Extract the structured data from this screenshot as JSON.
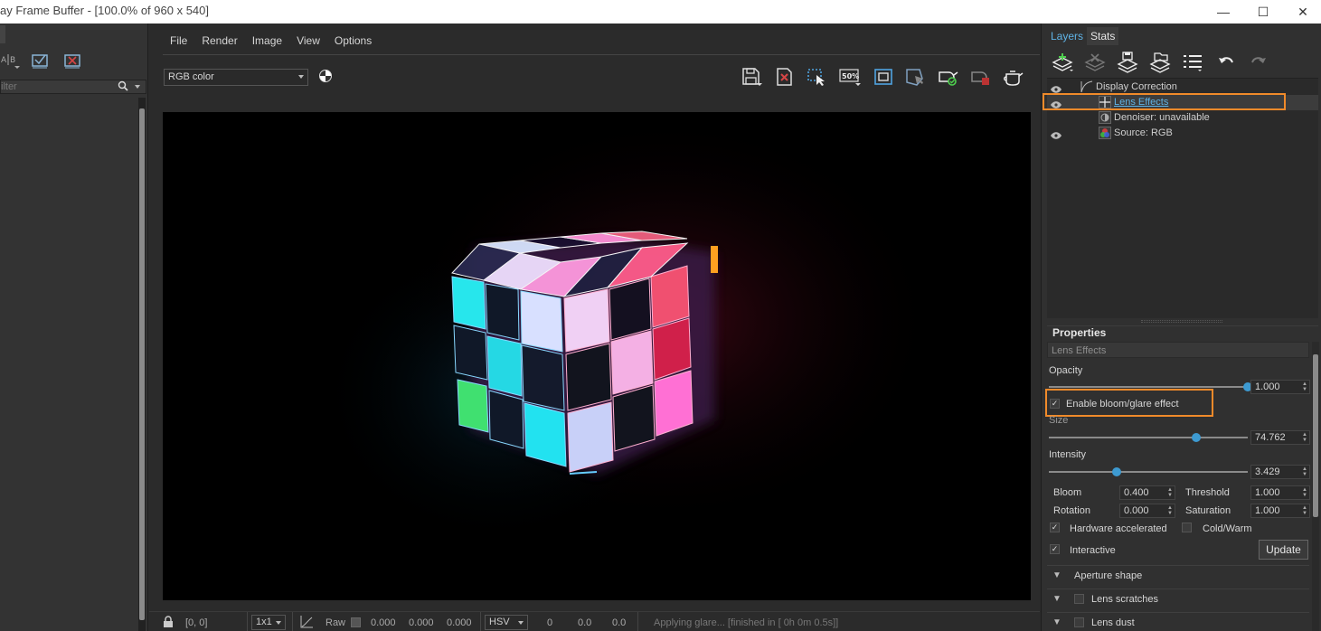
{
  "window": {
    "title": "ay Frame Buffer - [100.0% of 960 x 540]",
    "minimize_glyph": "—",
    "maximize_glyph": "☐",
    "close_glyph": "✕"
  },
  "left_panel": {
    "filter_placeholder": "ilter",
    "icons": [
      "ab-compare-icon",
      "check-all-icon",
      "clear-all-icon"
    ]
  },
  "menu": {
    "items": [
      "File",
      "Render",
      "Image",
      "View",
      "Options"
    ]
  },
  "toolbar": {
    "channel": "RGB color",
    "zoom_badge": "50%",
    "icons": [
      "save-icon",
      "clear-icon",
      "region-render-icon",
      "zoom-50-icon",
      "frame-icon",
      "track-mouse-icon",
      "render-icon",
      "stop-render-icon",
      "teapot-render-icon"
    ]
  },
  "statusbar": {
    "coords": "[0, 0]",
    "zoom": "1x1",
    "raw_label": "Raw",
    "r": "0.000",
    "g": "0.000",
    "b": "0.000",
    "color_mode": "HSV",
    "h": "0",
    "s": "0.0",
    "v": "0.0",
    "message": "Applying glare... [finished in [ 0h  0m  0.5s]]"
  },
  "right_panel": {
    "tabs": [
      "Layers",
      "Stats"
    ],
    "layers": [
      {
        "label": "Display Correction",
        "eye": true
      },
      {
        "label": "Lens Effects",
        "eye": true,
        "selected": true
      },
      {
        "label": "Denoiser: unavailable",
        "eye": false
      },
      {
        "label": "Source: RGB",
        "eye": true
      }
    ],
    "properties": {
      "title": "Properties",
      "subtitle": "Lens Effects",
      "opacity_label": "Opacity",
      "opacity_value": "1.000",
      "opacity_level": 1.0,
      "bloom_enable_label": "Enable bloom/glare effect",
      "size_label": "Size",
      "size_value": "74.762",
      "size_level": 0.74,
      "intensity_label": "Intensity",
      "intensity_value": "3.429",
      "intensity_level": 0.34,
      "bloom_label": "Bloom",
      "bloom_value": "0.400",
      "threshold_label": "Threshold",
      "threshold_value": "1.000",
      "rotation_label": "Rotation",
      "rotation_value": "0.000",
      "saturation_label": "Saturation",
      "saturation_value": "1.000",
      "hw_label": "Hardware accelerated",
      "coldwarm_label": "Cold/Warm",
      "interactive_label": "Interactive",
      "update_label": "Update",
      "sections": [
        "Aperture shape",
        "Lens scratches",
        "Lens dust"
      ]
    }
  },
  "colors": {
    "highlight": "#f08a2a",
    "accent": "#3d9ad1",
    "tab_active": "#5fb3e6"
  }
}
